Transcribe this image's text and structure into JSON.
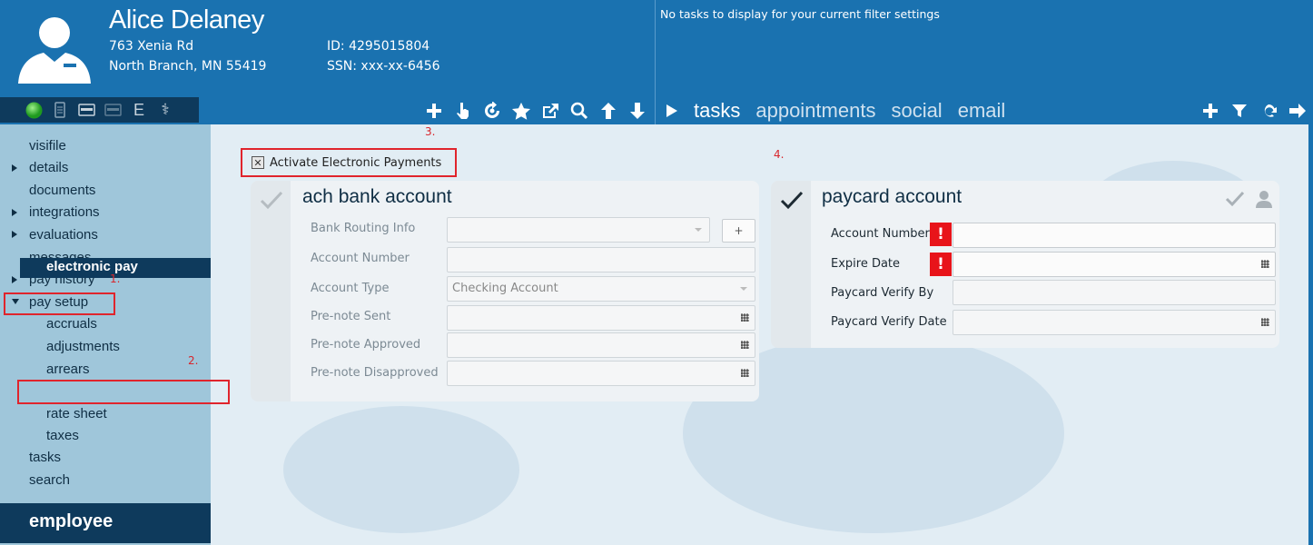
{
  "employee": {
    "name": "Alice Delaney",
    "address_line1": "763 Xenia Rd",
    "address_line2": "North Branch, MN 55419",
    "id_text": "ID: 4295015804",
    "ssn_text": "SSN: xxx-xx-6456"
  },
  "tasks_pane": {
    "message": "No tasks to display for your current filter settings",
    "tabs": [
      "tasks",
      "appointments",
      "social",
      "email"
    ]
  },
  "status_icons": [
    "status-green-icon",
    "document-icon",
    "card-icon",
    "card-outline-icon",
    "e-letter-icon",
    "caduceus-icon"
  ],
  "status_icon_glyphs": {
    "e": "E",
    "caduceus": "⚕"
  },
  "toolbar_icons": [
    "plus-icon",
    "pointer-hand-icon",
    "refresh-user-icon",
    "star-icon",
    "external-link-icon",
    "search-icon",
    "arrow-up-icon",
    "arrow-down-icon"
  ],
  "tab_action_icons": [
    "plus-icon",
    "filter-icon",
    "refresh-icon",
    "arrow-right-icon"
  ],
  "sidebar": {
    "items": [
      {
        "label": "visifile"
      },
      {
        "label": "details"
      },
      {
        "label": "documents"
      },
      {
        "label": "integrations"
      },
      {
        "label": "evaluations"
      },
      {
        "label": "messages"
      },
      {
        "label": "pay history"
      },
      {
        "label": "pay setup"
      },
      {
        "label": "tasks"
      },
      {
        "label": "search"
      }
    ],
    "subitems": [
      {
        "label": "accruals"
      },
      {
        "label": "adjustments"
      },
      {
        "label": "arrears"
      },
      {
        "label": "electronic pay"
      },
      {
        "label": "rate sheet"
      },
      {
        "label": "taxes"
      }
    ],
    "footer_label": "employee"
  },
  "annotations": [
    "1.",
    "2.",
    "3.",
    "4."
  ],
  "activate": {
    "label": "Activate Electronic Payments",
    "mark": "✕"
  },
  "ach_panel": {
    "title": "ach bank account",
    "add_button": "+",
    "fields": [
      {
        "label": "Bank Routing Info",
        "value": ""
      },
      {
        "label": "Account Number",
        "value": ""
      },
      {
        "label": "Account Type",
        "value": "Checking Account"
      },
      {
        "label": "Pre-note Sent",
        "value": ""
      },
      {
        "label": "Pre-note Approved",
        "value": ""
      },
      {
        "label": "Pre-note Disapproved",
        "value": ""
      }
    ]
  },
  "paycard_panel": {
    "title": "paycard account",
    "error_mark": "!",
    "fields": [
      {
        "label": "Account Number",
        "value": ""
      },
      {
        "label": "Expire Date",
        "value": ""
      },
      {
        "label": "Paycard Verify By",
        "value": ""
      },
      {
        "label": "Paycard Verify Date",
        "value": ""
      }
    ]
  },
  "colors": {
    "header_blue": "#1a72b0",
    "dark_navy": "#0e3a5c",
    "sidebar_bg": "#9fc6da",
    "annotation_red": "#e0242c",
    "error_red": "#e8141a"
  }
}
